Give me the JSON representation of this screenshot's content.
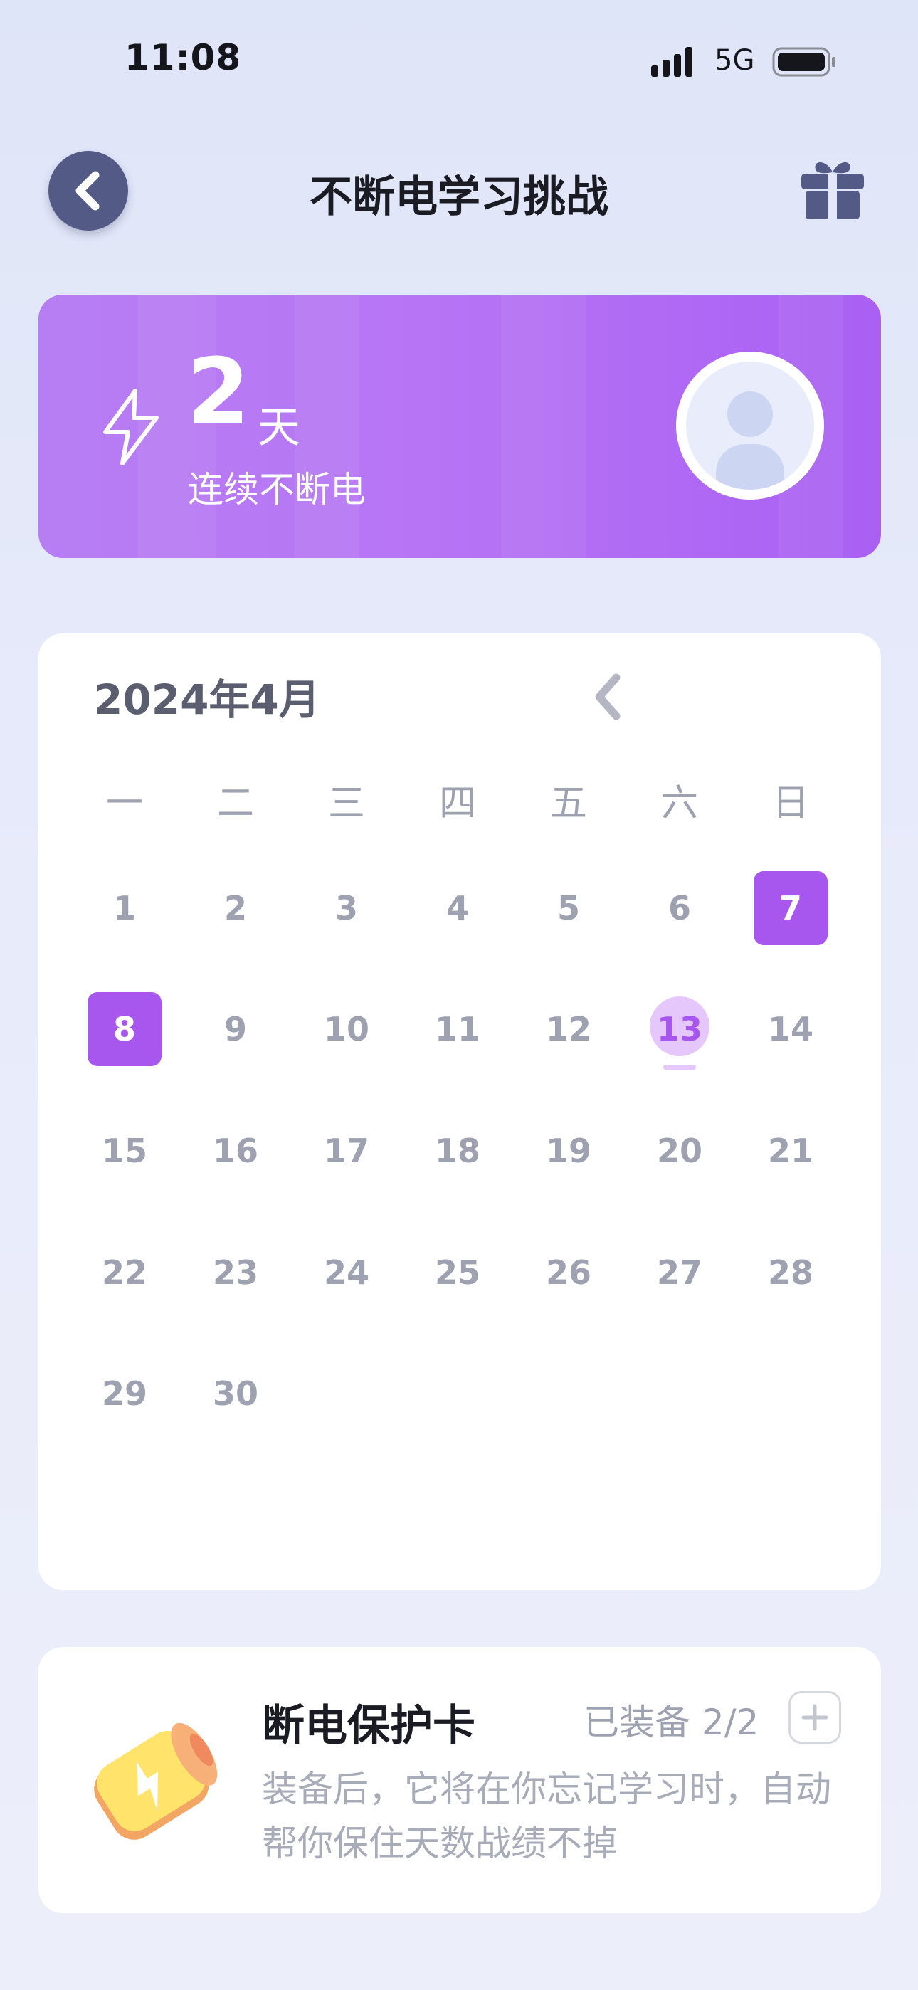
{
  "status_bar": {
    "time": "11:08",
    "network": "5G",
    "icons": [
      "signal-icon",
      "battery-icon"
    ]
  },
  "header": {
    "title": "不断电学习挑战",
    "back_icon": "chevron-left-icon",
    "gift_icon": "gift-icon"
  },
  "streak": {
    "days": "2",
    "unit": "天",
    "label": "连续不断电",
    "icon": "lightning-icon"
  },
  "calendar": {
    "month_label": "2024年4月",
    "weekdays": [
      "一",
      "二",
      "三",
      "四",
      "五",
      "六",
      "日"
    ],
    "days": [
      [
        "",
        "",
        "",
        "",
        "",
        "",
        "7"
      ],
      [
        "8",
        "9",
        "10",
        "11",
        "12",
        "13",
        "14"
      ],
      [
        "15",
        "16",
        "17",
        "18",
        "19",
        "20",
        "21"
      ],
      [
        "22",
        "23",
        "24",
        "25",
        "26",
        "27",
        "28"
      ],
      [
        "29",
        "30",
        "",
        "",
        "",
        "",
        ""
      ]
    ],
    "first_row": [
      "1",
      "2",
      "3",
      "4",
      "5",
      "6"
    ],
    "completed_days": [
      "7",
      "8"
    ],
    "today": "13",
    "accent_color": "#a757ee"
  },
  "protection_card": {
    "title": "断电保护卡",
    "equipped": "已装备 2/2",
    "description": "装备后，它将在你忘记学习时，自动帮你保住天数战绩不掉",
    "icon": "battery-card-icon"
  }
}
